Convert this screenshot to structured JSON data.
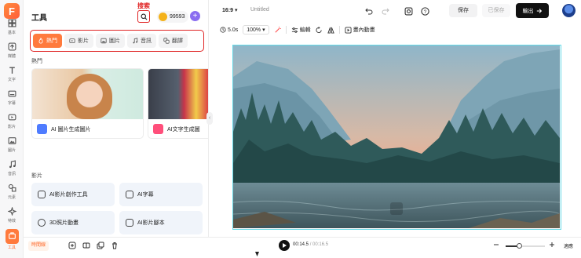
{
  "rail": {
    "items": [
      {
        "label": "基本",
        "icon": "grid-icon"
      },
      {
        "label": "媒體",
        "icon": "upload-icon"
      },
      {
        "label": "文字",
        "icon": "text-icon"
      },
      {
        "label": "字幕",
        "icon": "subtitle-icon"
      },
      {
        "label": "影片",
        "icon": "video-icon"
      },
      {
        "label": "圖片",
        "icon": "image-icon"
      },
      {
        "label": "音訊",
        "icon": "music-icon"
      },
      {
        "label": "元素",
        "icon": "elements-icon"
      },
      {
        "label": "特效",
        "icon": "effects-icon"
      },
      {
        "label": "工具",
        "icon": "tools-icon"
      }
    ]
  },
  "panel": {
    "title": "工具",
    "search_annotation": "搜索",
    "credits": "99593",
    "plus": "+",
    "tabs": [
      {
        "label": "熱門",
        "active": true
      },
      {
        "label": "影片",
        "active": false
      },
      {
        "label": "圖片",
        "active": false
      },
      {
        "label": "音訊",
        "active": false
      },
      {
        "label": "翻譯",
        "active": false
      }
    ],
    "hot_section": "熱門",
    "hot_cards": [
      {
        "label": "AI 圖片生成圖片"
      },
      {
        "label": "AI文字生成圖"
      }
    ],
    "video_section": "影片",
    "video_cards": [
      {
        "label": "AI影片創作工具"
      },
      {
        "label": "AI字幕"
      },
      {
        "label": "3D照片動畫"
      },
      {
        "label": "AI影片腳本"
      }
    ]
  },
  "topbar": {
    "ratio": "16:9",
    "doc_title": "Untitled",
    "save": "保存",
    "saved": "已保存",
    "export": "輸出"
  },
  "toolrow": {
    "duration": "5.0s",
    "zoom": "100%",
    "edit": "編輯",
    "animation": "畫內動畫"
  },
  "bottombar": {
    "timeline": "時間線",
    "current_time": "00:14.5",
    "total_time": "/ 00:16.5",
    "fit": "適應",
    "zoom_fraction": 0.35
  },
  "colors": {
    "accent": "#ff7a3d",
    "annotation": "#e02424",
    "canvas_border": "#66d9e6"
  }
}
